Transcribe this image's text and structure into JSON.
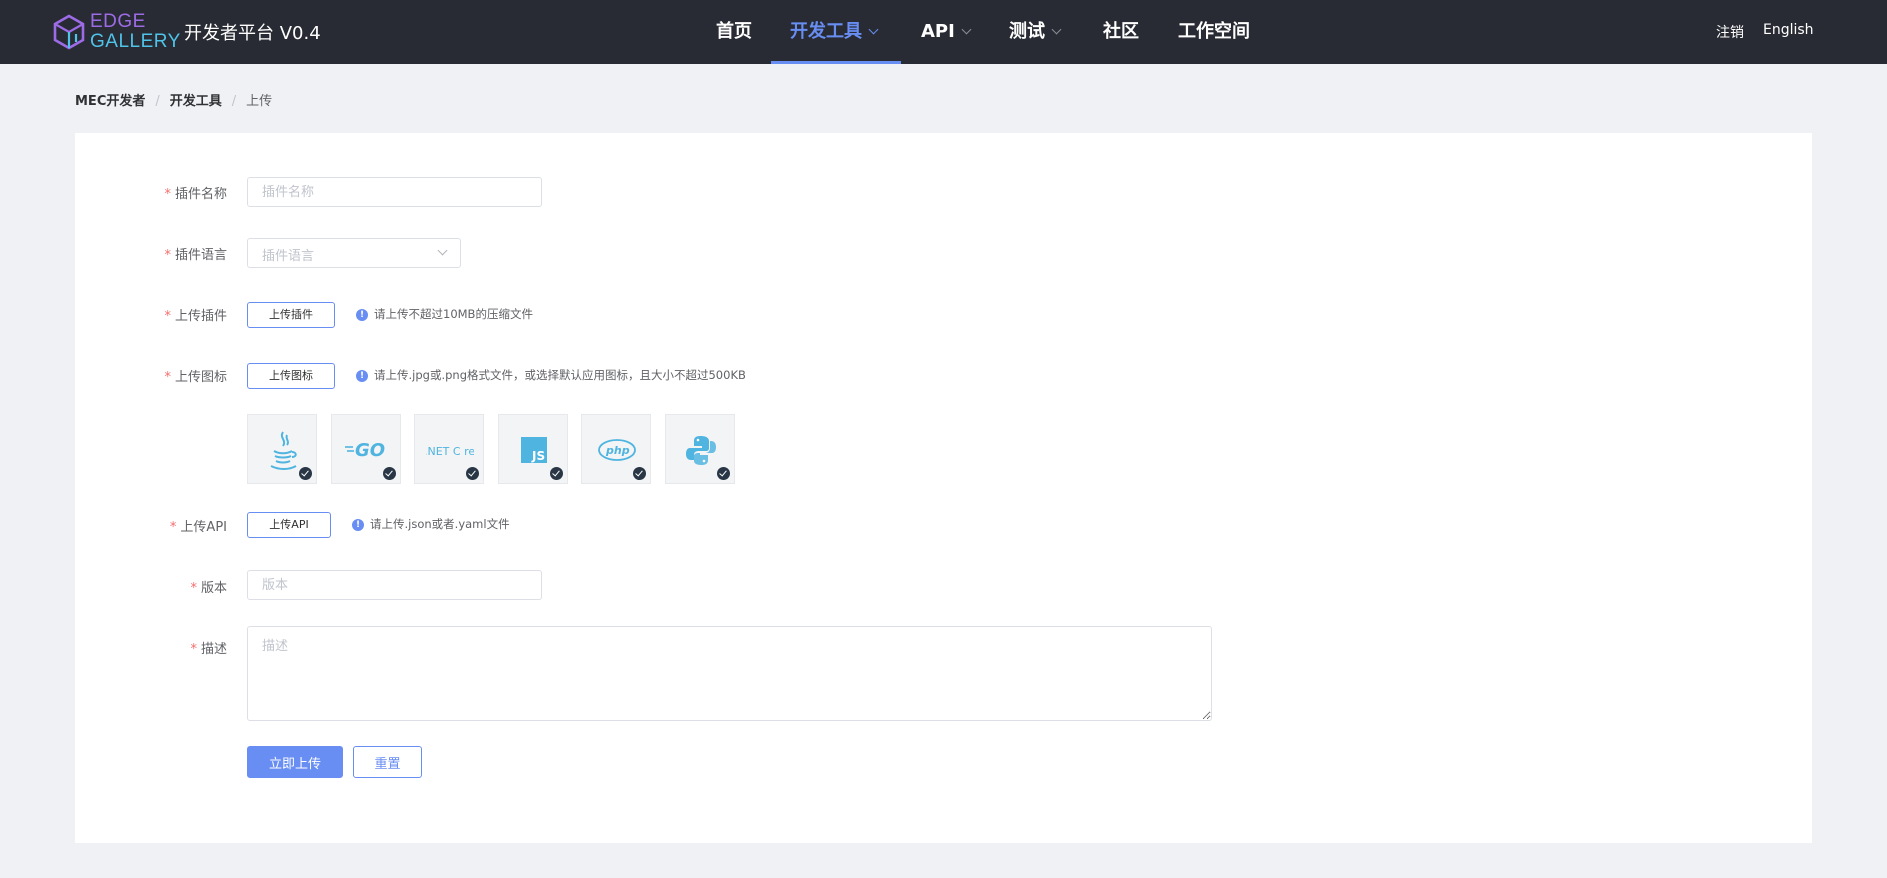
{
  "header": {
    "logo_line1": "EDGE",
    "logo_line2": "GALLERY",
    "platform_title": "开发者平台 V0.4",
    "nav": [
      {
        "label": "首页",
        "has_dropdown": false,
        "active": false
      },
      {
        "label": "开发工具",
        "has_dropdown": true,
        "active": true
      },
      {
        "label": "API",
        "has_dropdown": true,
        "active": false
      },
      {
        "label": "测试",
        "has_dropdown": true,
        "active": false
      },
      {
        "label": "社区",
        "has_dropdown": false,
        "active": false
      },
      {
        "label": "工作空间",
        "has_dropdown": false,
        "active": false
      }
    ],
    "logout": "注销",
    "language": "English"
  },
  "breadcrumb": [
    "MEC开发者",
    "开发工具",
    "上传"
  ],
  "form": {
    "plugin_name": {
      "label": "插件名称",
      "placeholder": "插件名称",
      "value": ""
    },
    "plugin_language": {
      "label": "插件语言",
      "placeholder": "插件语言",
      "value": ""
    },
    "upload_plugin": {
      "label": "上传插件",
      "button": "上传插件",
      "tip": "请上传不超过10MB的压缩文件"
    },
    "upload_icon": {
      "label": "上传图标",
      "button": "上传图标",
      "tip": "请上传.jpg或.png格式文件，或选择默认应用图标，且大小不超过500KB"
    },
    "default_icons": [
      "java-icon",
      "go-icon",
      "dotnet-core-icon",
      "javascript-icon",
      "php-icon",
      "python-icon"
    ],
    "default_icon_texts": {
      "go": "GO",
      "dotnet": ".NET C re",
      "js": "JS",
      "php": "php"
    },
    "upload_api": {
      "label": "上传API",
      "button": "上传API",
      "tip": "请上传.json或者.yaml文件"
    },
    "version": {
      "label": "版本",
      "placeholder": "版本",
      "value": ""
    },
    "description": {
      "label": "描述",
      "placeholder": "描述",
      "value": ""
    },
    "required_mark": "*",
    "submit": "立即上传",
    "reset": "重置"
  },
  "colors": {
    "header_bg": "#282b33",
    "accent": "#688ef3",
    "required": "#f56c6c",
    "page_bg": "#f0f1f5",
    "icon_blue": "#4fb4df"
  }
}
